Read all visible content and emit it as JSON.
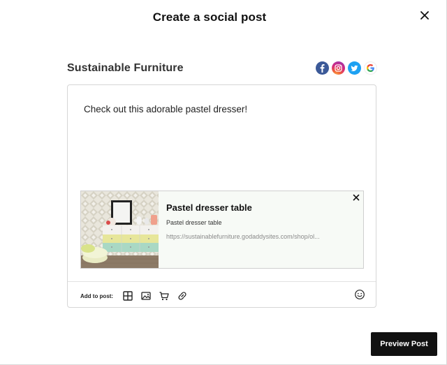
{
  "modal": {
    "title": "Create a social post"
  },
  "business": {
    "name": "Sustainable Furniture"
  },
  "social_icons": [
    "facebook-icon",
    "instagram-icon",
    "twitter-icon",
    "google-icon"
  ],
  "composer": {
    "text": "Check out this adorable pastel dresser!",
    "link_preview": {
      "title": "Pastel dresser table",
      "description": "Pastel dresser table",
      "url": "https://sustainablefurniture.godaddysites.com/shop/ol..."
    },
    "toolbar": {
      "add_label": "Add to post:",
      "tools": [
        "layout-icon",
        "image-icon",
        "cart-icon",
        "link-icon"
      ]
    }
  },
  "actions": {
    "preview_label": "Preview Post"
  },
  "colors": {
    "facebook": "#3b5998",
    "twitter": "#1da1f2",
    "button_bg": "#111111"
  }
}
